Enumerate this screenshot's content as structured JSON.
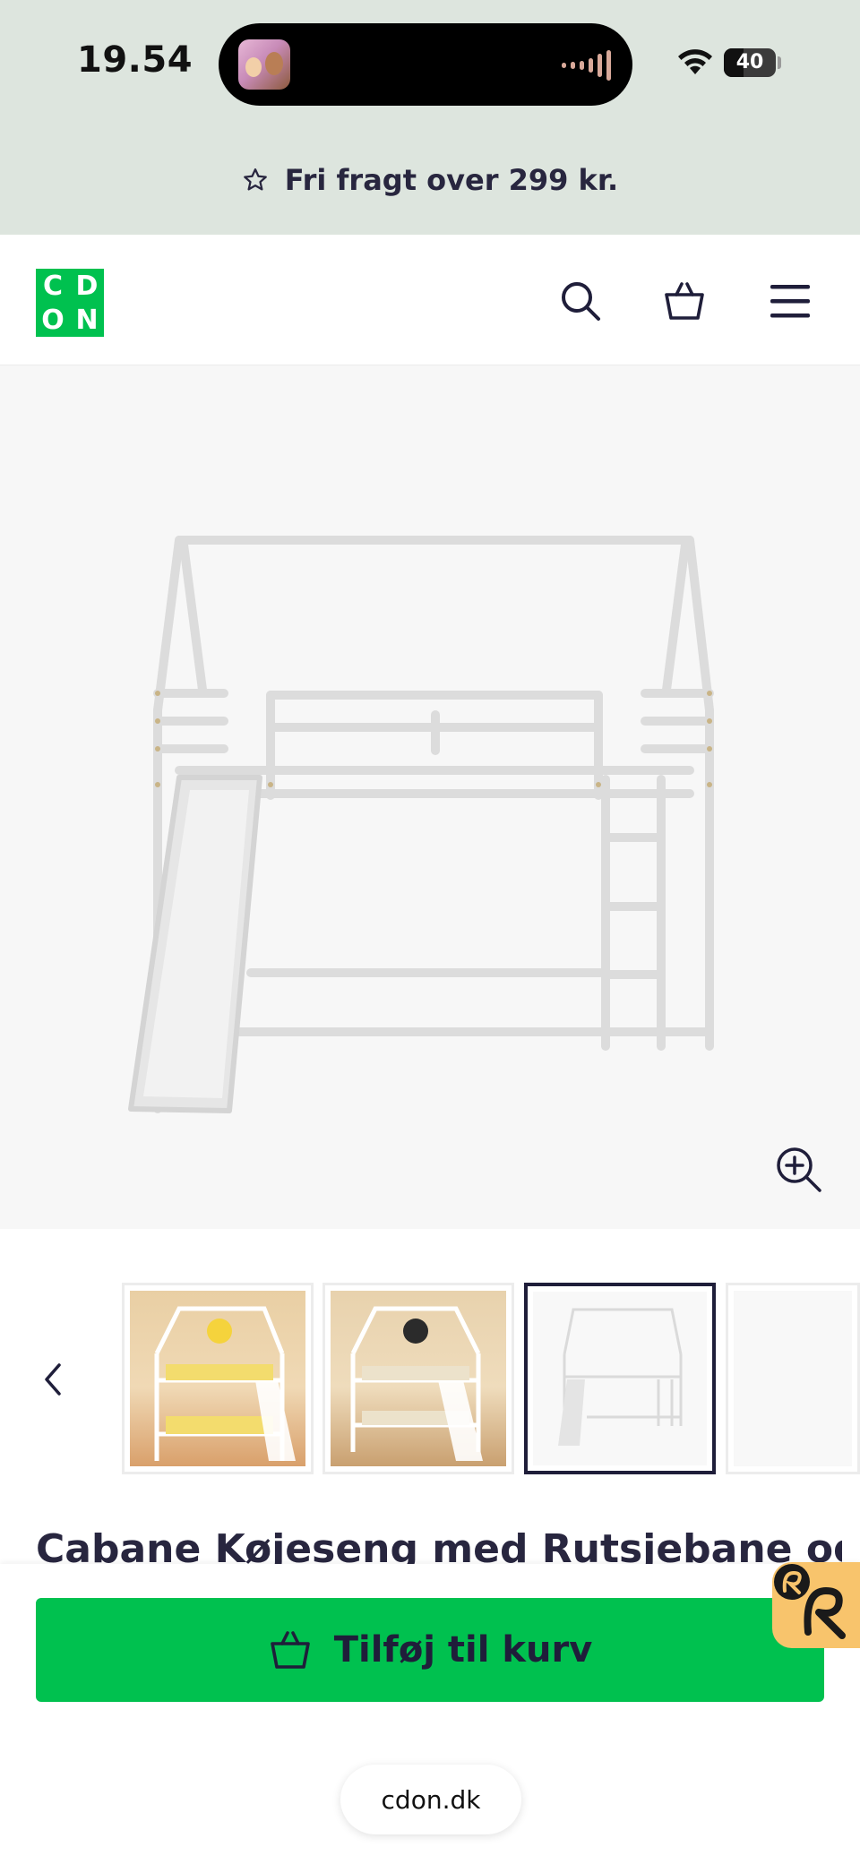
{
  "status": {
    "time": "19.54",
    "battery": "40"
  },
  "promo": {
    "text": "Fri fragt over 299 kr."
  },
  "header": {
    "logo_letters": [
      "C",
      "D",
      "O",
      "N"
    ],
    "brand_color": "#00c14f"
  },
  "product": {
    "title": "Cabane Køjeseng med Rutsjebane og",
    "add_to_cart_label": "Tilføj til kurv"
  },
  "browser": {
    "domain": "cdon.dk"
  },
  "colors": {
    "accent": "#00c14f",
    "text": "#1f1e3a",
    "promo_bg": "#dde5de"
  }
}
